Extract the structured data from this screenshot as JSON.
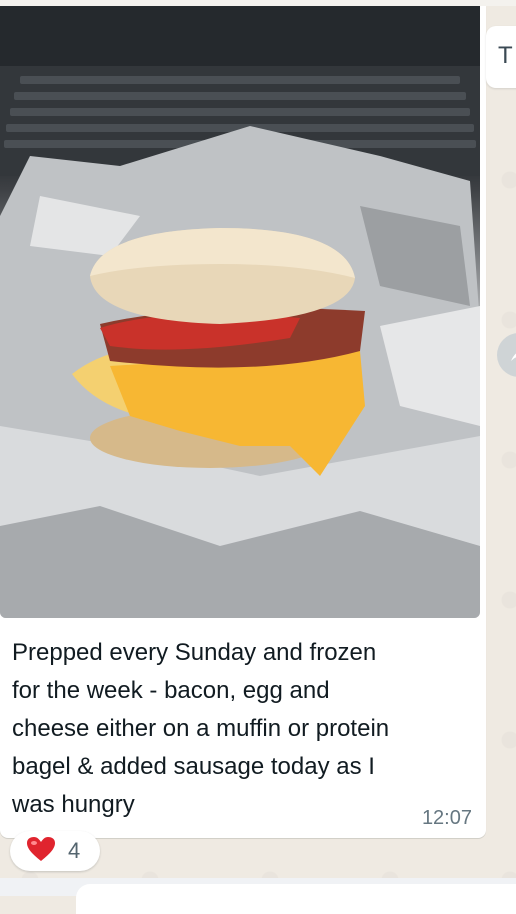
{
  "message": {
    "caption": "Prepped every Sunday and frozen\nfor the week - bacon, egg and\ncheese either on a muffin or protein\nbagel & added sausage today as I\nwas hungry",
    "time": "12:07",
    "photo_subject": "breakfast sandwich in foil"
  },
  "reaction": {
    "emoji": "heart-icon",
    "count": "4"
  },
  "right_tab": {
    "label": "T"
  },
  "colors": {
    "chat_background": "#efeae2",
    "bubble": "#ffffff",
    "text": "#111b21",
    "meta_text": "#667781",
    "reaction_heart": "#e0242e"
  }
}
